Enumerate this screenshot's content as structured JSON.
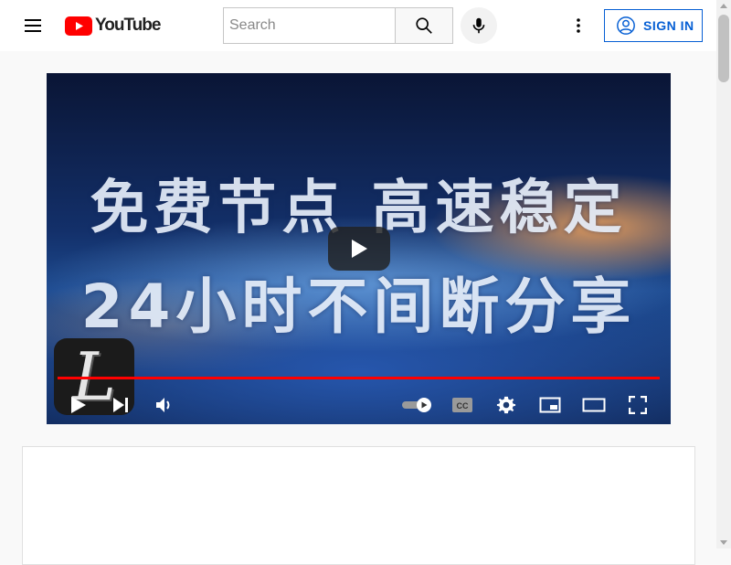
{
  "header": {
    "logo_text": "YouTube",
    "search_placeholder": "Search",
    "search_value": "",
    "signin_label": "SIGN IN",
    "icons": [
      "menu-icon",
      "youtube-logo-icon",
      "search-icon",
      "mic-icon",
      "more-vert-icon",
      "account-icon"
    ]
  },
  "player": {
    "title_line1": "免费节点  高速稳定",
    "title_line2": "24小时不间断分享",
    "watermark_letter": "L",
    "progress": 1.0,
    "controls": [
      "play-icon",
      "next-icon",
      "volume-icon",
      "autoplay-toggle-icon",
      "captions-icon",
      "settings-icon",
      "miniplayer-icon",
      "theater-mode-icon",
      "fullscreen-icon"
    ],
    "captions_label": "CC"
  },
  "colors": {
    "brand_red": "#ff0000",
    "accent_blue": "#065fd4",
    "page_background": "#f9f9f9"
  }
}
